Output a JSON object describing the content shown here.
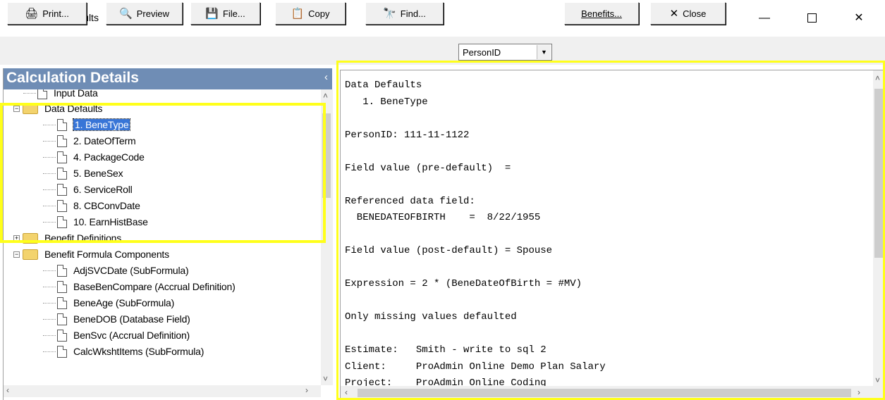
{
  "window": {
    "title": "Detailed Results",
    "app_icon": "A"
  },
  "window_controls": {
    "minimize": "—",
    "close": "✕"
  },
  "toolbar": {
    "print": "Print...",
    "preview": "Preview",
    "file": "File...",
    "copy": "Copy",
    "find": "Find...",
    "person_select": "PersonID",
    "benefits": "Benefits...",
    "close": "Close"
  },
  "left_panel": {
    "header": "Calculation Details",
    "tree": [
      {
        "label": "Input Data",
        "type": "doc"
      },
      {
        "label": "Data Defaults",
        "type": "folder",
        "expander": "−"
      },
      {
        "label": "1. BeneType",
        "type": "doc",
        "selected": true
      },
      {
        "label": "2. DateOfTerm",
        "type": "doc"
      },
      {
        "label": "4. PackageCode",
        "type": "doc"
      },
      {
        "label": "5. BeneSex",
        "type": "doc"
      },
      {
        "label": "6. ServiceRoll",
        "type": "doc"
      },
      {
        "label": "8. CBConvDate",
        "type": "doc"
      },
      {
        "label": "10. EarnHistBase",
        "type": "doc"
      },
      {
        "label": "Benefit Definitions",
        "type": "folder",
        "expander": "+"
      },
      {
        "label": "Benefit Formula Components",
        "type": "folder",
        "expander": "−"
      },
      {
        "label": "AdjSVCDate (SubFormula)",
        "type": "doc"
      },
      {
        "label": "BaseBenCompare (Accrual Definition)",
        "type": "doc"
      },
      {
        "label": "BeneAge (SubFormula)",
        "type": "doc"
      },
      {
        "label": "BeneDOB (Database Field)",
        "type": "doc"
      },
      {
        "label": "BenSvc (Accrual Definition)",
        "type": "doc"
      },
      {
        "label": "CalcWkshtItems (SubFormula)",
        "type": "doc"
      }
    ]
  },
  "report": {
    "lines": [
      "Data Defaults",
      "   1. BeneType",
      "",
      "PersonID: 111-11-1122",
      "",
      "Field value (pre-default)  =",
      "",
      "Referenced data field:",
      "  BENEDATEOFBIRTH    =  8/22/1955",
      "",
      "Field value (post-default) = Spouse",
      "",
      "Expression = 2 * (BeneDateOfBirth = #MV)",
      "",
      "Only missing values defaulted",
      "",
      "Estimate:   Smith - write to sql 2",
      "Client:     ProAdmin Online Demo Plan Salary",
      "Project:    ProAdmin Online Coding"
    ]
  },
  "colors": {
    "header_bg": "#6f8db5",
    "highlight": "#ffff1a",
    "selection": "#3875d7"
  }
}
